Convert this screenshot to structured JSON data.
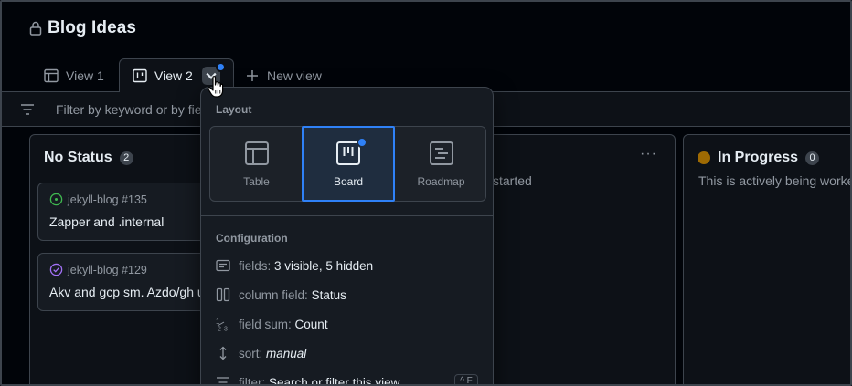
{
  "project": {
    "title": "Blog Ideas",
    "lock_icon": "lock-icon"
  },
  "tabs": [
    {
      "label": "View 1",
      "icon": "table-icon"
    },
    {
      "label": "View 2",
      "icon": "board-icon"
    },
    {
      "label": "New view",
      "icon": "plus-icon"
    }
  ],
  "filter": {
    "placeholder": "Filter by keyword or by fie"
  },
  "columns": [
    {
      "title": "No Status",
      "count": "2",
      "cards": [
        {
          "repo": "jekyll-blog #135",
          "title": "Zapper and .internal",
          "state": "open"
        },
        {
          "repo": "jekyll-blog #129",
          "title": "Akv and gcp sm. Azdo/gh u",
          "state": "done"
        }
      ]
    },
    {
      "title": "",
      "description": "started"
    },
    {
      "title": "In Progress",
      "count": "0",
      "description": "This is actively being worke",
      "color": "#9e6a03"
    }
  ],
  "more_label": "···",
  "menu": {
    "layout_label": "Layout",
    "layouts": [
      {
        "label": "Table",
        "icon": "table-icon"
      },
      {
        "label": "Board",
        "icon": "board-icon"
      },
      {
        "label": "Roadmap",
        "icon": "roadmap-icon"
      }
    ],
    "configuration_label": "Configuration",
    "config": [
      {
        "key": "fields:",
        "value": "3 visible, 5 hidden",
        "icon": "fields-icon"
      },
      {
        "key": "column field:",
        "value": "Status",
        "icon": "columns-icon"
      },
      {
        "key": "field sum:",
        "value": "Count",
        "icon": "sum-icon"
      },
      {
        "key": "sort:",
        "value": "manual",
        "icon": "sort-icon"
      },
      {
        "key": "filter:",
        "value": "Search or filter this view",
        "icon": "filter-icon"
      }
    ],
    "shortcut": "^ F"
  },
  "colors": {
    "accent": "#2f81f7",
    "in_progress": "#9e6a03",
    "open": "#3fb950",
    "done": "#a371f7"
  }
}
